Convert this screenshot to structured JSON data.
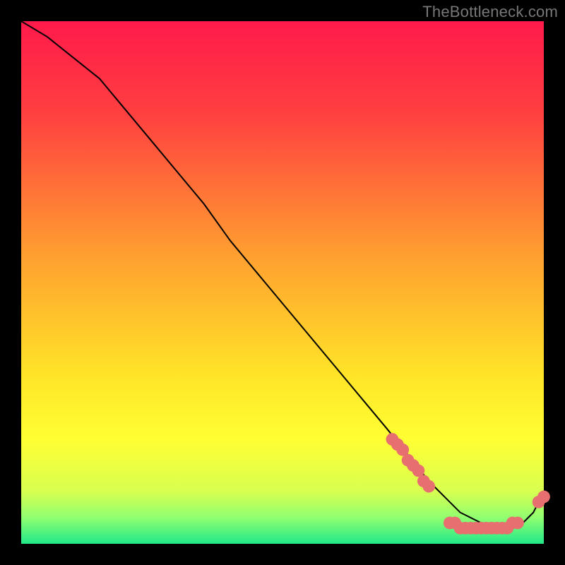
{
  "watermark": "TheBottleneck.com",
  "chart_data": {
    "type": "line",
    "title": "",
    "xlabel": "",
    "ylabel": "",
    "xlim": [
      0,
      100
    ],
    "ylim": [
      0,
      100
    ],
    "background_gradient": {
      "stops": [
        {
          "pct": 0,
          "color": "#ff1a4b"
        },
        {
          "pct": 18,
          "color": "#ff4040"
        },
        {
          "pct": 45,
          "color": "#ffa030"
        },
        {
          "pct": 68,
          "color": "#ffe528"
        },
        {
          "pct": 80,
          "color": "#ffff33"
        },
        {
          "pct": 90,
          "color": "#d8ff50"
        },
        {
          "pct": 95,
          "color": "#90ff70"
        },
        {
          "pct": 100,
          "color": "#20e88a"
        }
      ]
    },
    "series": [
      {
        "name": "curve",
        "color": "#000000",
        "x": [
          0,
          5,
          10,
          15,
          20,
          25,
          30,
          35,
          40,
          45,
          50,
          55,
          60,
          65,
          70,
          74,
          78,
          80,
          82,
          84,
          86,
          88,
          90,
          92,
          94,
          96,
          97,
          98,
          99,
          100
        ],
        "y": [
          100,
          97,
          93,
          89,
          83,
          77,
          71,
          65,
          58,
          52,
          46,
          40,
          34,
          28,
          22,
          17,
          12,
          10,
          8,
          6,
          5,
          4,
          3,
          3,
          3,
          4,
          5,
          6,
          8,
          9
        ]
      }
    ],
    "points": [
      {
        "x": 71,
        "y": 20
      },
      {
        "x": 72,
        "y": 19
      },
      {
        "x": 73,
        "y": 18
      },
      {
        "x": 74,
        "y": 16
      },
      {
        "x": 75,
        "y": 15
      },
      {
        "x": 76,
        "y": 14
      },
      {
        "x": 77,
        "y": 12
      },
      {
        "x": 78,
        "y": 11
      },
      {
        "x": 82,
        "y": 4
      },
      {
        "x": 83,
        "y": 4
      },
      {
        "x": 84,
        "y": 3
      },
      {
        "x": 85,
        "y": 3
      },
      {
        "x": 86,
        "y": 3
      },
      {
        "x": 87,
        "y": 3
      },
      {
        "x": 88,
        "y": 3
      },
      {
        "x": 89,
        "y": 3
      },
      {
        "x": 90,
        "y": 3
      },
      {
        "x": 91,
        "y": 3
      },
      {
        "x": 92,
        "y": 3
      },
      {
        "x": 93,
        "y": 3
      },
      {
        "x": 94,
        "y": 4
      },
      {
        "x": 95,
        "y": 4
      },
      {
        "x": 99,
        "y": 8
      },
      {
        "x": 100,
        "y": 9
      }
    ],
    "point_color": "#e76f6f",
    "point_radius": 1.2
  }
}
